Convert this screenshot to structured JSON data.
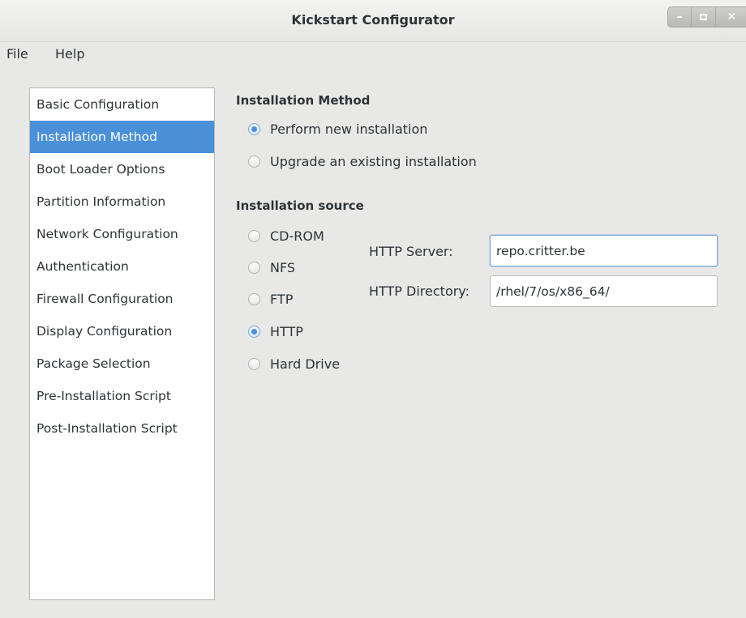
{
  "window": {
    "title": "Kickstart Configurator",
    "controls": [
      "minimize-icon",
      "maximize-icon",
      "close-icon"
    ]
  },
  "menubar": {
    "file": "File",
    "help": "Help"
  },
  "sidebar": {
    "items": [
      {
        "label": "Basic Configuration",
        "selected": false
      },
      {
        "label": "Installation Method",
        "selected": true
      },
      {
        "label": "Boot Loader Options",
        "selected": false
      },
      {
        "label": "Partition Information",
        "selected": false
      },
      {
        "label": "Network Configuration",
        "selected": false
      },
      {
        "label": "Authentication",
        "selected": false
      },
      {
        "label": "Firewall Configuration",
        "selected": false
      },
      {
        "label": "Display Configuration",
        "selected": false
      },
      {
        "label": "Package Selection",
        "selected": false
      },
      {
        "label": "Pre-Installation Script",
        "selected": false
      },
      {
        "label": "Post-Installation Script",
        "selected": false
      }
    ]
  },
  "installation_method": {
    "heading": "Installation Method",
    "options": [
      {
        "label": "Perform new installation",
        "checked": true
      },
      {
        "label": "Upgrade an existing installation",
        "checked": false
      }
    ]
  },
  "installation_source": {
    "heading": "Installation source",
    "options": [
      {
        "label": "CD-ROM",
        "checked": false
      },
      {
        "label": "NFS",
        "checked": false
      },
      {
        "label": "FTP",
        "checked": false
      },
      {
        "label": "HTTP",
        "checked": true
      },
      {
        "label": "Hard Drive",
        "checked": false
      }
    ],
    "http_server_label": "HTTP Server:",
    "http_server_value": "repo.critter.be",
    "http_directory_label": "HTTP Directory:",
    "http_directory_value": "/rhel/7/os/x86_64/"
  },
  "colors": {
    "selection": "#4a90d9",
    "background": "#e8e8e7"
  }
}
